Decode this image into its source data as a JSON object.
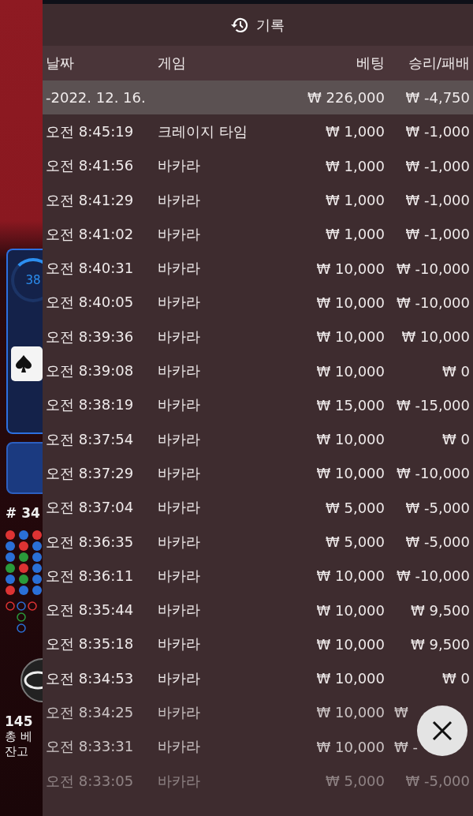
{
  "background": {
    "progress_text": "38",
    "round": "# 34",
    "players": "145",
    "total_bet": "총 베",
    "balance": "잔고"
  },
  "history": {
    "title": "기록",
    "columns": [
      "날짜",
      "게임",
      "베팅",
      "승리/패배"
    ],
    "summary": {
      "date": "-2022. 12. 16.",
      "bet": "₩ 226,000",
      "result": "₩ -4,750"
    },
    "rows": [
      {
        "time": "오전 8:45:19",
        "game": "크레이지 타임",
        "bet": "₩ 1,000",
        "result": "₩ -1,000"
      },
      {
        "time": "오전 8:41:56",
        "game": "바카라",
        "bet": "₩ 1,000",
        "result": "₩ -1,000"
      },
      {
        "time": "오전 8:41:29",
        "game": "바카라",
        "bet": "₩ 1,000",
        "result": "₩ -1,000"
      },
      {
        "time": "오전 8:41:02",
        "game": "바카라",
        "bet": "₩ 1,000",
        "result": "₩ -1,000"
      },
      {
        "time": "오전 8:40:31",
        "game": "바카라",
        "bet": "₩ 10,000",
        "result": "₩ -10,000"
      },
      {
        "time": "오전 8:40:05",
        "game": "바카라",
        "bet": "₩ 10,000",
        "result": "₩ -10,000"
      },
      {
        "time": "오전 8:39:36",
        "game": "바카라",
        "bet": "₩ 10,000",
        "result": "₩ 10,000"
      },
      {
        "time": "오전 8:39:08",
        "game": "바카라",
        "bet": "₩ 10,000",
        "result": "₩ 0"
      },
      {
        "time": "오전 8:38:19",
        "game": "바카라",
        "bet": "₩ 15,000",
        "result": "₩ -15,000"
      },
      {
        "time": "오전 8:37:54",
        "game": "바카라",
        "bet": "₩ 10,000",
        "result": "₩ 0"
      },
      {
        "time": "오전 8:37:29",
        "game": "바카라",
        "bet": "₩ 10,000",
        "result": "₩ -10,000"
      },
      {
        "time": "오전 8:37:04",
        "game": "바카라",
        "bet": "₩ 5,000",
        "result": "₩ -5,000"
      },
      {
        "time": "오전 8:36:35",
        "game": "바카라",
        "bet": "₩ 5,000",
        "result": "₩ -5,000"
      },
      {
        "time": "오전 8:36:11",
        "game": "바카라",
        "bet": "₩ 10,000",
        "result": "₩ -10,000"
      },
      {
        "time": "오전 8:35:44",
        "game": "바카라",
        "bet": "₩ 10,000",
        "result": "₩ 9,500"
      },
      {
        "time": "오전 8:35:18",
        "game": "바카라",
        "bet": "₩ 10,000",
        "result": "₩ 9,500"
      },
      {
        "time": "오전 8:34:53",
        "game": "바카라",
        "bet": "₩ 10,000",
        "result": "₩ 0"
      },
      {
        "time": "오전 8:34:25",
        "game": "바카라",
        "bet": "₩ 10,000",
        "result": "₩",
        "covered": true
      },
      {
        "time": "오전 8:33:31",
        "game": "바카라",
        "bet": "₩ 10,000",
        "result": "₩ -",
        "covered": true
      },
      {
        "time": "오전 8:33:05",
        "game": "바카라",
        "bet": "₩ 5,000",
        "result": "₩ -5,000"
      }
    ]
  }
}
